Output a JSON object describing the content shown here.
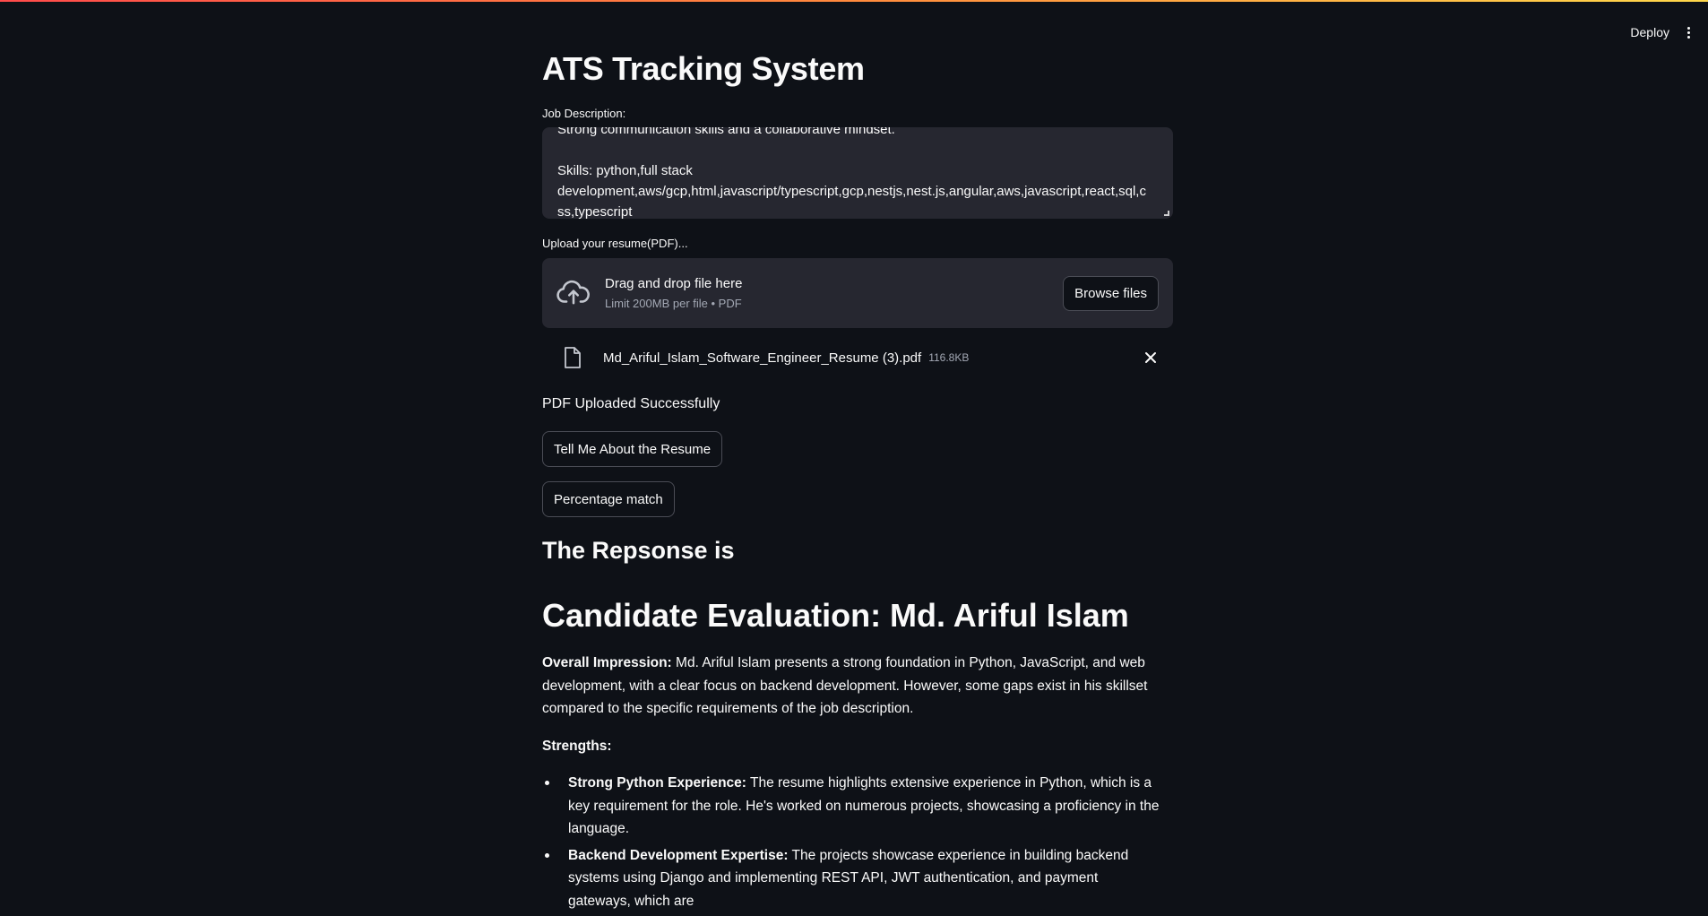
{
  "header": {
    "deploy_label": "Deploy",
    "menu_icon": "kebab-menu-icon"
  },
  "page": {
    "title": "ATS Tracking System"
  },
  "job_description": {
    "label": "Job Description:",
    "text": "Strong communication skills and a collaborative mindset.\n\nSkills: python,full stack development,aws/gcp,html,javascript/typescript,gcp,nestjs,nest.js,angular,aws,javascript,react,sql,css,typescript"
  },
  "upload": {
    "label": "Upload your resume(PDF)...",
    "drop_title": "Drag and drop file here",
    "drop_limit": "Limit 200MB per file • PDF",
    "browse_label": "Browse files",
    "file_name": "Md_Ariful_Islam_Software_Engineer_Resume (3).pdf",
    "file_size": "116.8KB"
  },
  "status": {
    "message": "PDF Uploaded Successfully"
  },
  "actions": {
    "tell_label": "Tell Me About the Resume",
    "match_label": "Percentage match"
  },
  "response": {
    "heading": "The Repsonse is",
    "eval_title": "Candidate Evaluation: Md. Ariful Islam",
    "overall_label": "Overall Impression:",
    "overall_text": " Md. Ariful Islam presents a strong foundation in Python, JavaScript, and web development, with a clear focus on backend development. However, some gaps exist in his skillset compared to the specific requirements of the job description.",
    "strengths_label": "Strengths:",
    "strengths": [
      {
        "label": "Strong Python Experience:",
        "text": " The resume highlights extensive experience in Python, which is a key requirement for the role. He's worked on numerous projects, showcasing a proficiency in the language."
      },
      {
        "label": "Backend Development Expertise:",
        "text": " The projects showcase experience in building backend systems using Django and implementing REST API, JWT authentication, and payment gateways, which are"
      }
    ]
  },
  "colors": {
    "background": "#0e1117",
    "panel": "#262730",
    "text": "#fafafa",
    "muted": "#a3a8b4",
    "accent_red": "#ff4b4b"
  }
}
